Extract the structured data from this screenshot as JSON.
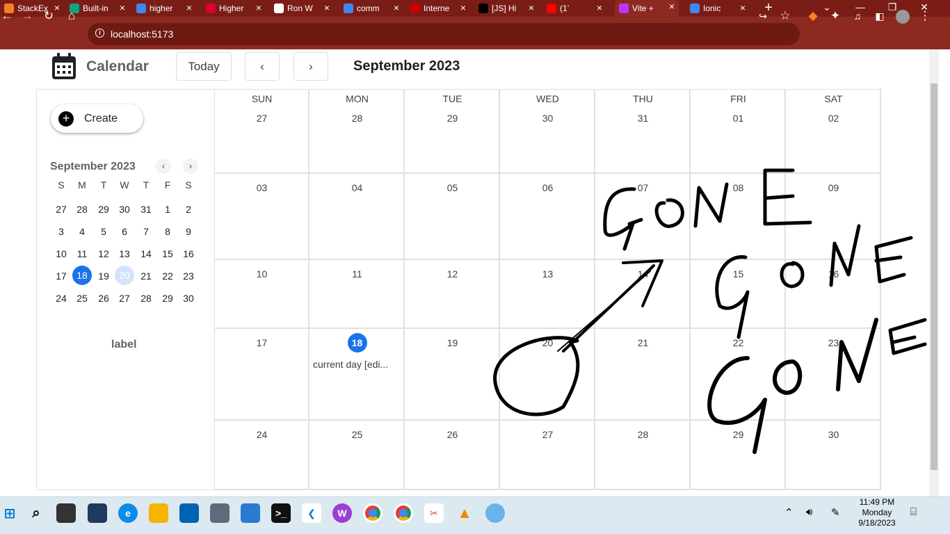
{
  "browser": {
    "tabs": [
      {
        "title": "StackEx",
        "icon": "stackoverflow-icon",
        "color": "#f48024"
      },
      {
        "title": "Built-in",
        "icon": "chatgpt-icon",
        "color": "#10a37f"
      },
      {
        "title": "higher",
        "icon": "google-icon",
        "color": "#4285f4"
      },
      {
        "title": "Higher",
        "icon": "angular-icon",
        "color": "#dd0031"
      },
      {
        "title": "Ron W",
        "icon": "doc-icon",
        "color": "#ffffff"
      },
      {
        "title": "comm",
        "icon": "google-icon",
        "color": "#4285f4"
      },
      {
        "title": "Interne",
        "icon": "internet-icon",
        "color": "#cc0000"
      },
      {
        "title": "[JS] Hi",
        "icon": "medium-icon",
        "color": "#000000"
      },
      {
        "title": "(1’",
        "icon": "youtube-icon",
        "color": "#ff0000"
      },
      {
        "title": "Vite +",
        "icon": "vite-icon",
        "color": "#bd34fe"
      },
      {
        "title": "Ionic",
        "icon": "google-icon",
        "color": "#4285f4"
      }
    ],
    "active_tab_index": 9,
    "url": "localhost:5173",
    "theme_color": "#8c2a22"
  },
  "app": {
    "title": "Calendar",
    "today_label": "Today",
    "prev_label": "‹",
    "next_label": "›",
    "month_title": "September 2023",
    "create_label": "Create",
    "label_text": "label",
    "accent": "#1a73e8"
  },
  "mini_calendar": {
    "title": "September 2023",
    "prev": "‹",
    "next": "›",
    "dow": [
      "S",
      "M",
      "T",
      "W",
      "T",
      "F",
      "S"
    ],
    "weeks": [
      [
        "27",
        "28",
        "29",
        "30",
        "31",
        "1",
        "2"
      ],
      [
        "3",
        "4",
        "5",
        "6",
        "7",
        "8",
        "9"
      ],
      [
        "10",
        "11",
        "12",
        "13",
        "14",
        "15",
        "16"
      ],
      [
        "17",
        "18",
        "19",
        "20",
        "21",
        "22",
        "23"
      ],
      [
        "24",
        "25",
        "26",
        "27",
        "28",
        "29",
        "30"
      ]
    ],
    "today": "18",
    "selected": "20"
  },
  "month_grid": {
    "dow": [
      "SUN",
      "MON",
      "TUE",
      "WED",
      "THU",
      "FRI",
      "SAT"
    ],
    "weeks": [
      [
        "27",
        "28",
        "29",
        "30",
        "31",
        "01",
        "02"
      ],
      [
        "03",
        "04",
        "05",
        "06",
        "07",
        "08",
        "09"
      ],
      [
        "10",
        "11",
        "12",
        "13",
        "14",
        "15",
        "16"
      ],
      [
        "17",
        "18",
        "19",
        "20",
        "21",
        "22",
        "23"
      ],
      [
        "24",
        "25",
        "26",
        "27",
        "28",
        "29",
        "30"
      ]
    ],
    "today": "18",
    "event": {
      "date": "18",
      "title": "current day [edi..."
    }
  },
  "taskbar": {
    "time": "11:49 PM",
    "day": "Monday",
    "date": "9/18/2023"
  }
}
